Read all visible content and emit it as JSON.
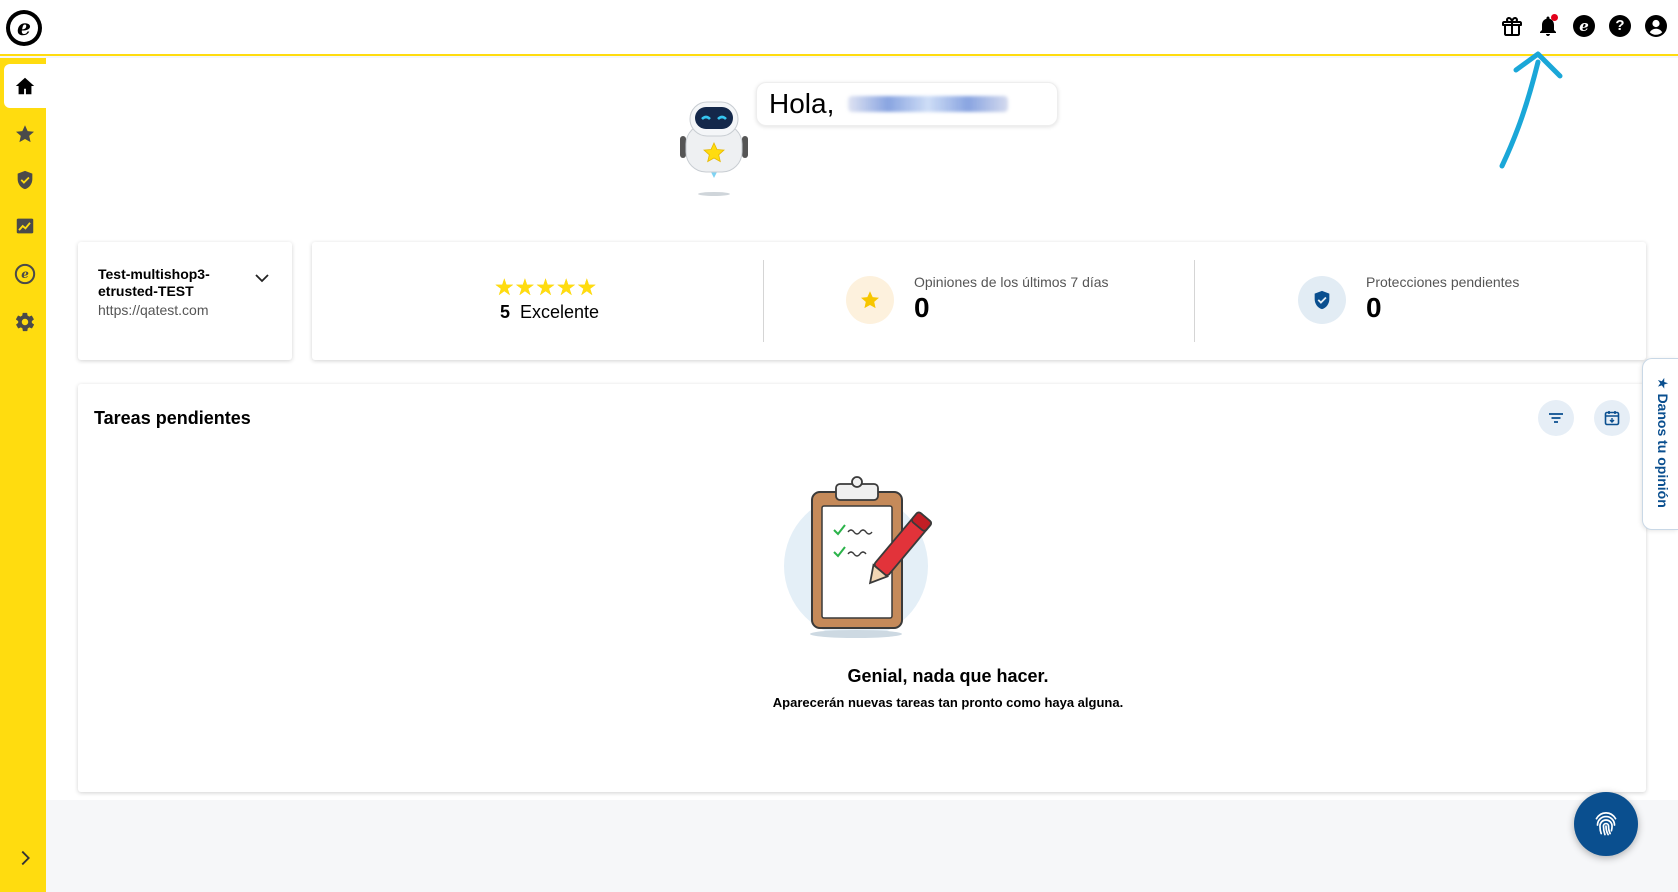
{
  "header": {
    "logo_letter": "e",
    "icons": [
      "gift-icon",
      "bell-icon",
      "trusted-e-icon",
      "help-icon",
      "account-icon"
    ],
    "e_letter": "e",
    "help_letter": "?"
  },
  "sidebar": {
    "items": [
      "home-icon",
      "star-icon",
      "shield-check-icon",
      "chart-icon",
      "trusted-e-icon",
      "gear-icon"
    ],
    "expand": "chevron-right-icon"
  },
  "greeting": {
    "text": "Hola,"
  },
  "shop": {
    "name": "Test-multishop3-etrusted-TEST",
    "url": "https://qatest.com"
  },
  "stats": {
    "rating_value": "5",
    "rating_label": "Excelente",
    "stars": "★★★★★",
    "reviews_label": "Opiniones de los últimos 7 días",
    "reviews_value": "0",
    "protections_label": "Protecciones pendientes",
    "protections_value": "0"
  },
  "tasks": {
    "title": "Tareas pendientes",
    "empty_title": "Genial, nada que hacer.",
    "empty_subtitle": "Aparecerán nuevas tareas tan pronto como haya alguna."
  },
  "feedback": {
    "label": "★ Danos tu opinión"
  },
  "colors": {
    "brand_yellow": "#ffdc0f",
    "brand_blue": "#0a4f8f",
    "annotation_arrow": "#1aa7d8"
  }
}
